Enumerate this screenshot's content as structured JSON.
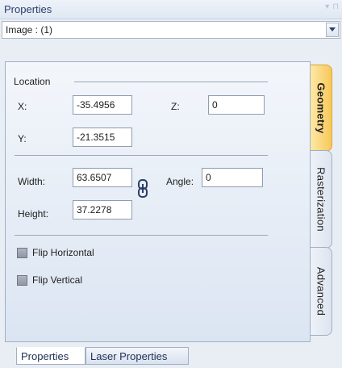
{
  "window": {
    "title": "Properties"
  },
  "combo": {
    "value": "Image : (1)"
  },
  "location": {
    "section_label": "Location",
    "x_label": "X:",
    "x_value": "-35.4956",
    "y_label": "Y:",
    "y_value": "-21.3515",
    "z_label": "Z:",
    "z_value": "0"
  },
  "size": {
    "width_label": "Width:",
    "width_value": "63.6507",
    "height_label": "Height:",
    "height_value": "37.2278",
    "angle_label": "Angle:",
    "angle_value": "0"
  },
  "flip": {
    "horizontal_label": "Flip Horizontal",
    "vertical_label": "Flip Vertical"
  },
  "side_tabs": [
    "Geometry",
    "Rasterization",
    "Advanced"
  ],
  "active_side_tab": "Geometry",
  "bottom_tabs": [
    "Properties",
    "Laser Properties"
  ],
  "active_bottom_tab": "Properties",
  "colors": {
    "active_tab": "#f7c85a",
    "panel": "#dbe5f2"
  }
}
